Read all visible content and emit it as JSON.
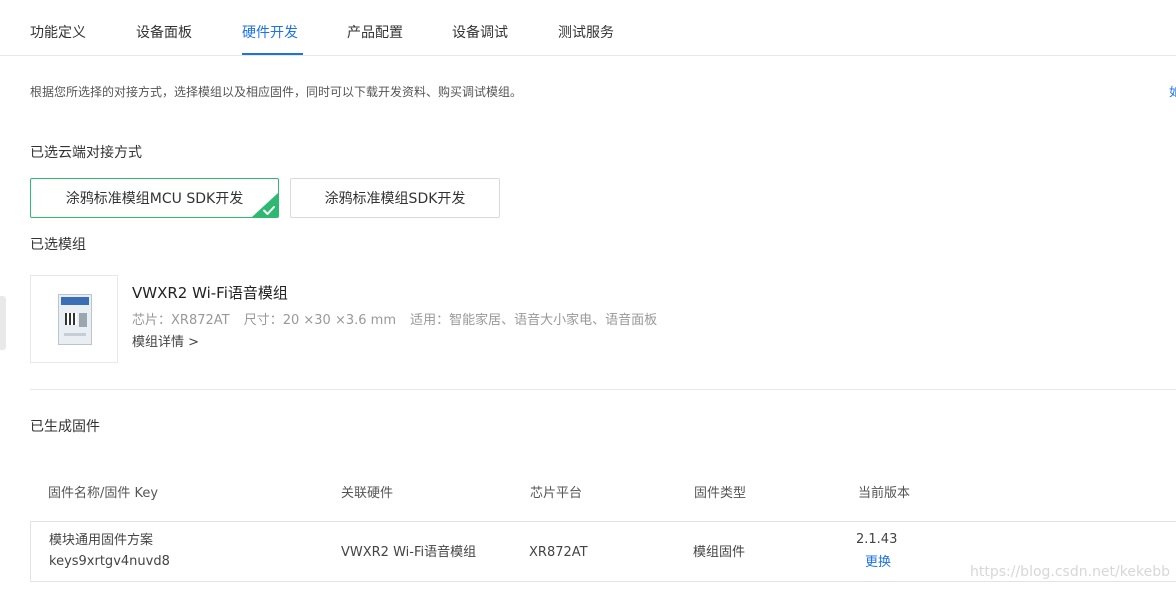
{
  "tabs": [
    {
      "label": "功能定义"
    },
    {
      "label": "设备面板"
    },
    {
      "label": "硬件开发"
    },
    {
      "label": "产品配置"
    },
    {
      "label": "设备调试"
    },
    {
      "label": "测试服务"
    }
  ],
  "active_tab": "硬件开发",
  "description": "根据您所选择的对接方式，选择模组以及相应固件，同时可以下载开发资料、购买调试模组。",
  "description_link_fragment": "如",
  "cloud_section": {
    "title": "已选云端对接方式",
    "options": [
      {
        "label": "涂鸦标准模组MCU SDK开发",
        "selected": true
      },
      {
        "label": "涂鸦标准模组SDK开发",
        "selected": false
      }
    ]
  },
  "module_section": {
    "title": "已选模组",
    "name": "VWXR2 Wi-Fi语音模组",
    "chip": "芯片：XR872AT",
    "size": "尺寸：20 ×30 ×3.6 mm",
    "usage": "适用：智能家居、语音大小家电、语音面板",
    "detail_link": "模组详情 >"
  },
  "firmware_section": {
    "title": "已生成固件",
    "columns": [
      "固件名称/固件 Key",
      "关联硬件",
      "芯片平台",
      "固件类型",
      "当前版本"
    ],
    "rows": [
      {
        "name": "模块通用固件方案",
        "key": "keys9xrtgv4nuvd8",
        "hardware": "VWXR2 Wi-Fi语音模组",
        "chip_platform": "XR872AT",
        "type": "模组固件",
        "version": "2.1.43",
        "action": "更换"
      }
    ]
  },
  "watermark": "https://blog.csdn.net/kekebb",
  "colors": {
    "accent": "#1e72e6",
    "selected_green": "#2eb872"
  }
}
